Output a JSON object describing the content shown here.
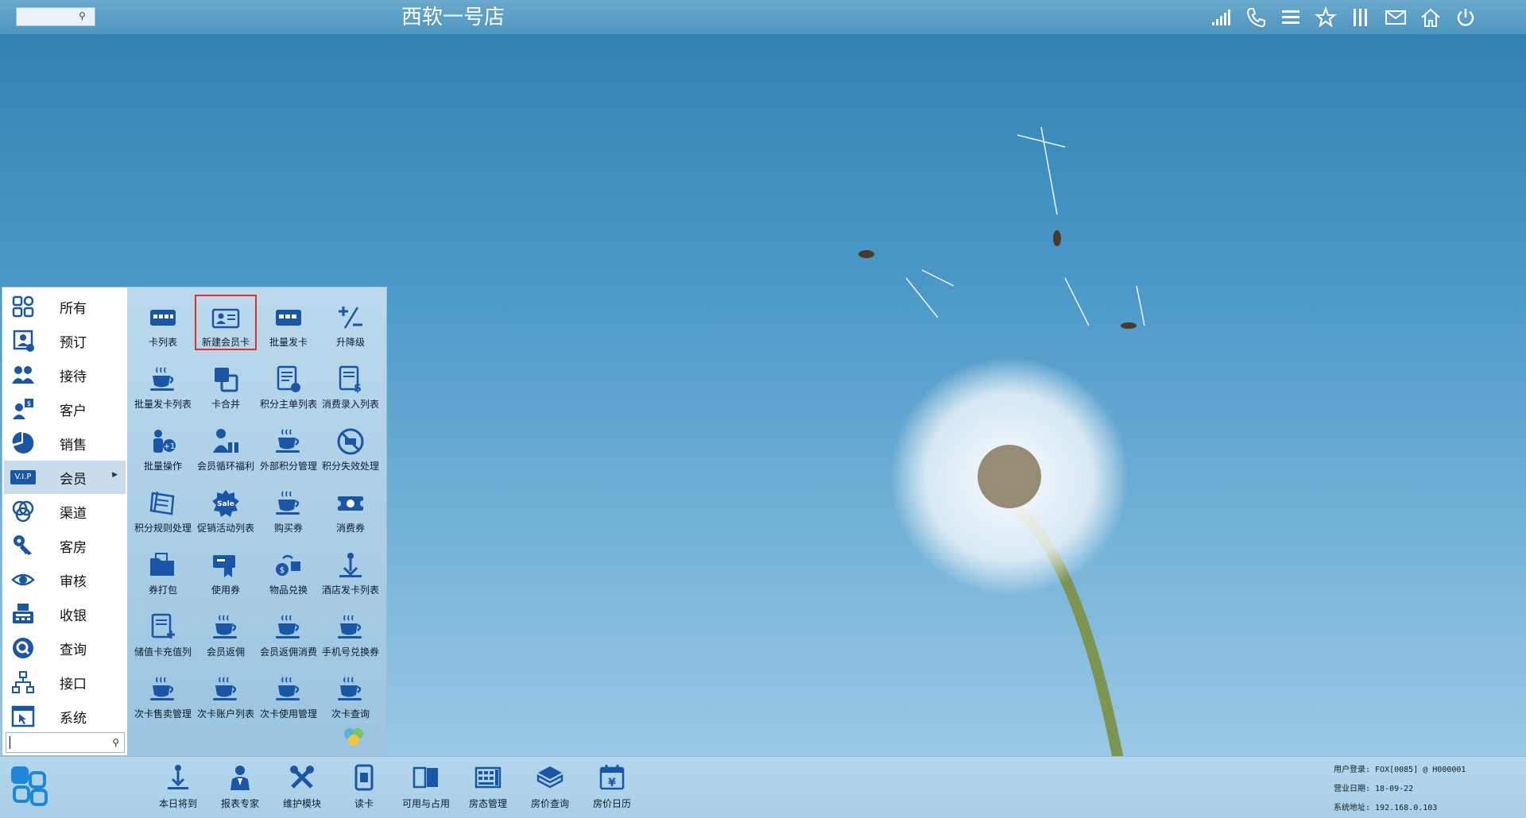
{
  "topbar": {
    "title": "西软一号店",
    "search_placeholder": "",
    "icons": [
      "signal-icon",
      "phone-icon",
      "menu-icon",
      "star-icon",
      "columns-icon",
      "mail-icon",
      "home-icon",
      "power-icon"
    ]
  },
  "menu": {
    "categories": [
      {
        "label": "所有",
        "icon": "apps-icon"
      },
      {
        "label": "预订",
        "icon": "booking-icon"
      },
      {
        "label": "接待",
        "icon": "reception-icon"
      },
      {
        "label": "客户",
        "icon": "customer-icon"
      },
      {
        "label": "销售",
        "icon": "sales-icon"
      },
      {
        "label": "会员",
        "icon": "vip-icon",
        "badge": "V.I.P"
      },
      {
        "label": "渠道",
        "icon": "channel-icon"
      },
      {
        "label": "客房",
        "icon": "room-icon"
      },
      {
        "label": "审核",
        "icon": "audit-icon"
      },
      {
        "label": "收银",
        "icon": "cashier-icon"
      },
      {
        "label": "查询",
        "icon": "query-icon"
      },
      {
        "label": "接口",
        "icon": "interface-icon"
      },
      {
        "label": "系统",
        "icon": "system-icon"
      }
    ],
    "active_category": "会员",
    "search_value": "",
    "tiles": [
      {
        "label": "卡列表",
        "icon": "card-list-icon"
      },
      {
        "label": "新建会员卡",
        "icon": "new-member-card-icon",
        "selected": true
      },
      {
        "label": "批量发卡",
        "icon": "batch-card-icon"
      },
      {
        "label": "升降级",
        "icon": "upgrade-icon"
      },
      {
        "label": "批量发卡列表",
        "icon": "coffee-cup-icon"
      },
      {
        "label": "卡合并",
        "icon": "card-merge-icon"
      },
      {
        "label": "积分主单列表",
        "icon": "points-list-icon"
      },
      {
        "label": "消费录入列表",
        "icon": "consume-list-icon"
      },
      {
        "label": "批量操作",
        "icon": "batch-op-icon"
      },
      {
        "label": "会员循环福利",
        "icon": "member-gift-icon"
      },
      {
        "label": "外部积分管理",
        "icon": "coffee-cup-icon"
      },
      {
        "label": "积分失效处理",
        "icon": "no-entry-icon"
      },
      {
        "label": "积分规则处理",
        "icon": "rules-icon"
      },
      {
        "label": "促销活动列表",
        "icon": "sale-icon"
      },
      {
        "label": "购买券",
        "icon": "coffee-cup-icon"
      },
      {
        "label": "消费券",
        "icon": "voucher-icon"
      },
      {
        "label": "券打包",
        "icon": "folder-icon"
      },
      {
        "label": "使用券",
        "icon": "use-voucher-icon"
      },
      {
        "label": "物品兑换",
        "icon": "exchange-icon"
      },
      {
        "label": "酒店发卡列表",
        "icon": "pin-icon"
      },
      {
        "label": "储值卡充值列",
        "icon": "recharge-icon"
      },
      {
        "label": "会员返佣",
        "icon": "coffee-cup-icon"
      },
      {
        "label": "会员返佣消费",
        "icon": "coffee-cup-icon"
      },
      {
        "label": "手机号兑换券",
        "icon": "coffee-cup-icon"
      },
      {
        "label": "次卡售卖管理",
        "icon": "coffee-cup-icon"
      },
      {
        "label": "次卡账户列表",
        "icon": "coffee-cup-icon"
      },
      {
        "label": "次卡使用管理",
        "icon": "coffee-cup-icon"
      },
      {
        "label": "次卡查询",
        "icon": "coffee-cup-icon"
      }
    ]
  },
  "taskbar": {
    "items": [
      {
        "label": "本日将到",
        "icon": "arrival-icon"
      },
      {
        "label": "报表专家",
        "icon": "report-expert-icon"
      },
      {
        "label": "维护模块",
        "icon": "tools-icon"
      },
      {
        "label": "读卡",
        "icon": "card-reader-icon"
      },
      {
        "label": "可用与占用",
        "icon": "availability-icon"
      },
      {
        "label": "房态管理",
        "icon": "room-status-icon"
      },
      {
        "label": "房价查询",
        "icon": "rate-query-icon"
      },
      {
        "label": "房价日历",
        "icon": "rate-calendar-icon"
      }
    ],
    "status": {
      "user": "用户登录: FOX[0085] @ H000001",
      "business_date": "营业日期: 18-09-22",
      "system_address": "系统地址: 192.168.0.103"
    }
  },
  "colors": {
    "accent": "#1a56a6",
    "selected_border": "#e03131",
    "active_category_bg": "#c9dcec"
  }
}
